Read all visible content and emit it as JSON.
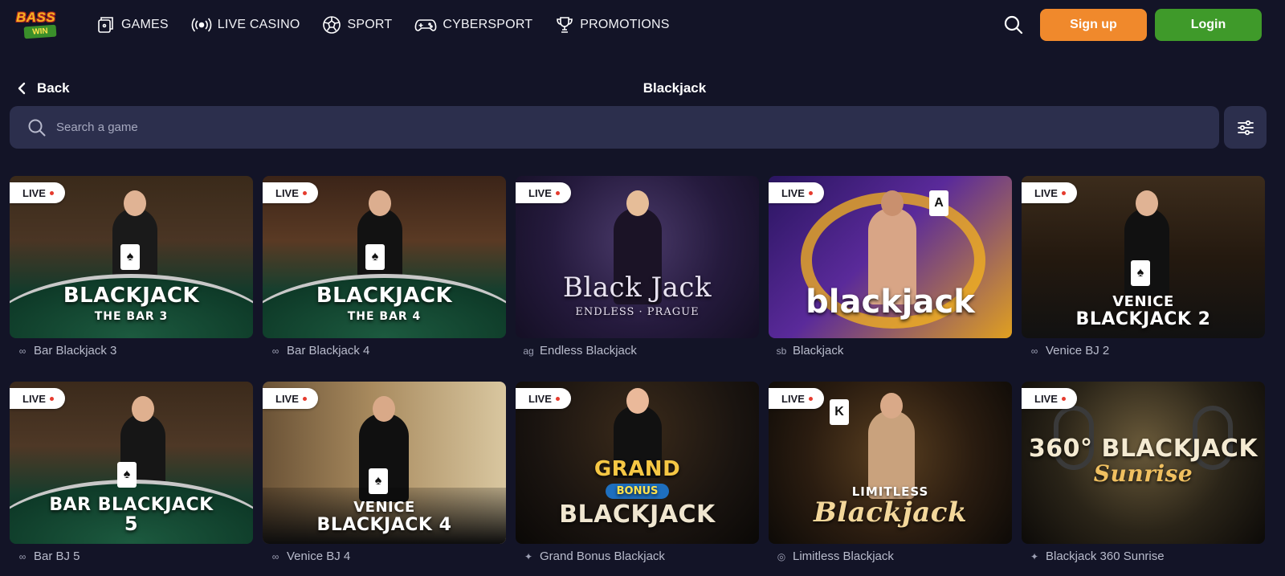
{
  "header": {
    "logo_top": "BASS",
    "logo_bottom": "WIN",
    "nav": [
      {
        "label": "GAMES",
        "icon": "games-icon"
      },
      {
        "label": "LIVE CASINO",
        "icon": "live-broadcast-icon"
      },
      {
        "label": "SPORT",
        "icon": "soccer-ball-icon"
      },
      {
        "label": "CYBERSPORT",
        "icon": "gamepad-icon"
      },
      {
        "label": "PROMOTIONS",
        "icon": "trophy-icon"
      }
    ],
    "signup_label": "Sign up",
    "login_label": "Login"
  },
  "subheader": {
    "back_label": "Back",
    "title": "Blackjack"
  },
  "search": {
    "placeholder": "Search a game"
  },
  "colors": {
    "background": "#131427",
    "panel": "#2c2f4d",
    "signup": "#f0892c",
    "login": "#3f9a2a",
    "live_dot": "#e53b2e"
  },
  "games": [
    {
      "name": "Bar Blackjack 3",
      "provider_icon": "link-icon",
      "badge": "LIVE",
      "art_title": "BLACKJACK",
      "art_sub": "THE BAR 3"
    },
    {
      "name": "Bar Blackjack 4",
      "provider_icon": "link-icon",
      "badge": "LIVE",
      "art_title": "BLACKJACK",
      "art_sub": "THE BAR 4"
    },
    {
      "name": "Endless Blackjack",
      "provider_icon": "ag-provider-icon",
      "badge": "LIVE",
      "art_title": "Black Jack",
      "art_sub": "ENDLESS · PRAGUE"
    },
    {
      "name": "Blackjack",
      "provider_icon": "sb-provider-icon",
      "badge": "LIVE",
      "art_title": "blackjack",
      "art_sub": ""
    },
    {
      "name": "Venice BJ 2",
      "provider_icon": "link-icon",
      "badge": "LIVE",
      "art_title": "VENICE",
      "art_sub": "BLACKJACK 2"
    },
    {
      "name": "Bar BJ 5",
      "provider_icon": "link-icon",
      "badge": "LIVE",
      "art_title": "BAR BLACKJACK",
      "art_sub": "5"
    },
    {
      "name": "Venice BJ 4",
      "provider_icon": "link-icon",
      "badge": "LIVE",
      "art_title": "VENICE",
      "art_sub": "BLACKJACK 4"
    },
    {
      "name": "Grand Bonus Blackjack",
      "provider_icon": "star-provider-icon",
      "badge": "LIVE",
      "art_title": "GRAND",
      "art_sub": "BLACKJACK"
    },
    {
      "name": "Limitless Blackjack",
      "provider_icon": "circle-provider-icon",
      "badge": "LIVE",
      "art_title": "LIMITLESS",
      "art_sub": "Blackjack"
    },
    {
      "name": "Blackjack 360 Sunrise",
      "provider_icon": "star-provider-icon",
      "badge": "LIVE",
      "art_title": "360° BLACKJACK",
      "art_sub": "Sunrise"
    }
  ]
}
